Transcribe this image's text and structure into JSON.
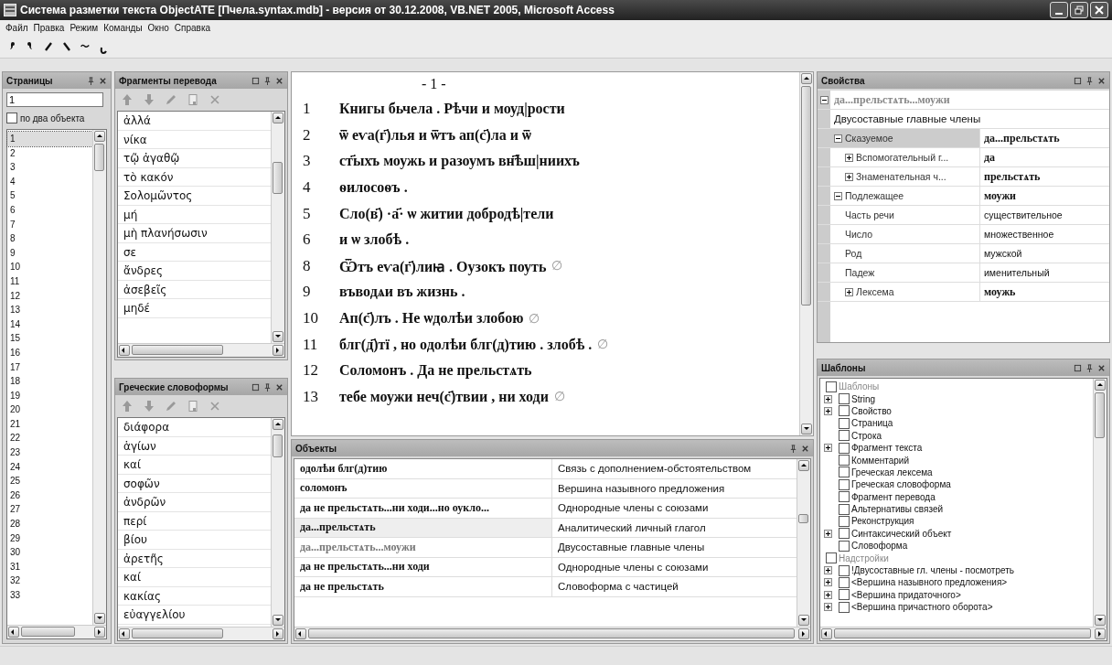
{
  "window": {
    "title": "Система разметки текста ObjectATE [Пчела.syntax.mdb] - версия от 30.12.2008, VB.NET 2005, Microsoft Access"
  },
  "menu": [
    "Файл",
    "Правка",
    "Режим",
    "Команды",
    "Окно",
    "Справка"
  ],
  "pages_pane": {
    "title": "Страницы",
    "page_field": "1",
    "pairs_checkbox": {
      "label": "по два объекта",
      "checked": false
    },
    "pages": [
      {
        "label": "1",
        "selected": true
      },
      {
        "label": "2",
        "selected": false
      },
      {
        "label": "3",
        "selected": false
      },
      {
        "label": "4",
        "selected": false
      },
      {
        "label": "5",
        "selected": false
      },
      {
        "label": "6",
        "selected": false
      },
      {
        "label": "7",
        "selected": false
      },
      {
        "label": "8",
        "selected": false
      },
      {
        "label": "9",
        "selected": false
      },
      {
        "label": "10",
        "selected": false
      },
      {
        "label": "11",
        "selected": false
      },
      {
        "label": "12",
        "selected": false
      },
      {
        "label": "13",
        "selected": false
      },
      {
        "label": "14",
        "selected": false
      },
      {
        "label": "15",
        "selected": false
      },
      {
        "label": "16",
        "selected": false
      },
      {
        "label": "17",
        "selected": false
      },
      {
        "label": "18",
        "selected": false
      },
      {
        "label": "19",
        "selected": false
      },
      {
        "label": "20",
        "selected": false
      },
      {
        "label": "21",
        "selected": false
      },
      {
        "label": "22",
        "selected": false
      },
      {
        "label": "23",
        "selected": false
      },
      {
        "label": "24",
        "selected": false
      },
      {
        "label": "25",
        "selected": false
      },
      {
        "label": "26",
        "selected": false
      },
      {
        "label": "27",
        "selected": false
      },
      {
        "label": "28",
        "selected": false
      },
      {
        "label": "29",
        "selected": false
      },
      {
        "label": "30",
        "selected": false
      },
      {
        "label": "31",
        "selected": false
      },
      {
        "label": "32",
        "selected": false
      },
      {
        "label": "33",
        "selected": false
      }
    ]
  },
  "fragments_pane": {
    "title": "Фрагменты перевода",
    "items": [
      "ἀλλά",
      "νίκα",
      "τῷ ἀγαθῷ",
      "τὸ κακόν",
      "Σολομῶντος",
      "μή",
      "μὴ πλανήσωσιν",
      "σε",
      "ἄνδρες",
      "ἀσεβεῖς",
      "μηδέ"
    ]
  },
  "greek_pane": {
    "title": "Греческие словоформы",
    "items": [
      "διάφορα",
      "ἁγίων",
      "καί",
      "σοφῶν",
      "ἀνδρῶν",
      "περί",
      "βίου",
      "ἀρετῆς",
      "καί",
      "κακίας",
      "εὐαγγελίου"
    ]
  },
  "text_view": {
    "page_label": "- 1 -",
    "lines": [
      {
        "number": "1",
        "text": "Книгы бьчела . Рѣчи и моуд|рости"
      },
      {
        "number": "2",
        "text": "ѿ еѵа(г҃)лья и ѿтъ ап(с҃)ла и ѿ"
      },
      {
        "number": "3",
        "text": "ст҃ыхъ моужь и разоумъ вн҃ѣш|ниихъ"
      },
      {
        "number": "4",
        "text": "ѳилосоѳъ ."
      },
      {
        "number": "5",
        "text": "Сло(в҃) ·а҃· ѡ житии добродѣ|тели"
      },
      {
        "number": "6",
        "text": "и ѡ злобѣ ."
      },
      {
        "number": "8",
        "text": "Ѿтъ еѵа(г҃)лиꙗ . Оузокъ поуть",
        "mark": "∅"
      },
      {
        "number": "9",
        "text": "въводѧи въ жизнь ."
      },
      {
        "number": "10",
        "text": "Ап(с҃)лъ . Не ѡдолѣи злобою",
        "mark": "∅"
      },
      {
        "number": "11",
        "text": "блг(д҃)тї , но одолѣи блг(д)тию . злобѣ .",
        "mark": "∅"
      },
      {
        "number": "12",
        "text": "Соломонъ . Да не прельстѧть"
      },
      {
        "number": "13",
        "text": "тебе моужи неч(с҃)твии , ни ходи",
        "mark": "∅"
      }
    ]
  },
  "objects_pane": {
    "title": "Объекты",
    "rows": [
      {
        "fragment": "одолѣи блг(д)тию",
        "type": "Связь с дополнением-обстоятельством",
        "selected": false,
        "current": false
      },
      {
        "fragment": "соломонъ",
        "type": "Вершина назывного предложения",
        "selected": false,
        "current": false
      },
      {
        "fragment": "да не прельстѧть...ни ходи...но оукло...",
        "type": "Однородные члены с союзами",
        "selected": false,
        "current": false
      },
      {
        "fragment": "да...прельстѧть",
        "type": "Аналитический личный глагол",
        "selected": true,
        "current": false
      },
      {
        "fragment": "да...прельстѧть...моужи",
        "type": "Двусоставные главные члены",
        "selected": false,
        "current": true
      },
      {
        "fragment": "да не прельстѧть...ни ходи",
        "type": "Однородные члены с союзами",
        "selected": false,
        "current": false
      },
      {
        "fragment": "да не прельстѧть",
        "type": "Словоформа с частицей",
        "selected": false,
        "current": false
      }
    ]
  },
  "properties_pane": {
    "title": "Свойства",
    "object": "да...прельстѧть...моужи",
    "object_expanded": true,
    "object_type": "Двусоставные главные члены",
    "rows": [
      {
        "name": "Сказуемое",
        "value": "да...прельстѧть",
        "expanded": true,
        "selected": true,
        "children": [
          {
            "name": "Вспомогательный г...",
            "value": "да",
            "expanded": false,
            "selected": false
          },
          {
            "name": "Знаменательная ч...",
            "value": "прельстѧть",
            "expanded": false,
            "selected": false
          }
        ]
      },
      {
        "name": "Подлежащее",
        "value": "моужи",
        "expanded": true,
        "selected": false,
        "children": [
          {
            "name": "Часть речи",
            "value": "существительное",
            "selected": false
          },
          {
            "name": "Число",
            "value": "множественное",
            "selected": false
          },
          {
            "name": "Род",
            "value": "мужской",
            "selected": false
          },
          {
            "name": "Падеж",
            "value": "именительный",
            "selected": false
          },
          {
            "name": "Лексема",
            "value": "моужь",
            "expanded": false,
            "selected": false
          }
        ]
      }
    ]
  },
  "templates_pane": {
    "title": "Шаблоны",
    "tree": [
      {
        "label": "Шаблоны",
        "checked": false,
        "children": [
          {
            "label": "String",
            "checked": false,
            "expanded": false
          },
          {
            "label": "Свойство",
            "checked": false,
            "expanded": false
          },
          {
            "label": "Страница",
            "checked": false
          },
          {
            "label": "Строка",
            "checked": false
          },
          {
            "label": "Фрагмент текста",
            "checked": false,
            "expanded": false
          },
          {
            "label": "Комментарий",
            "checked": false
          },
          {
            "label": "Греческая лексема",
            "checked": false
          },
          {
            "label": "Греческая словоформа",
            "checked": false
          },
          {
            "label": "Фрагмент перевода",
            "checked": false
          },
          {
            "label": "Альтернативы связей",
            "checked": false
          },
          {
            "label": "Реконструкция",
            "checked": false
          },
          {
            "label": "Синтаксический объект",
            "checked": false,
            "expanded": false
          },
          {
            "label": "Словоформа",
            "checked": false
          }
        ]
      },
      {
        "label": "Надстройки",
        "checked": false,
        "children": [
          {
            "label": "!Двусоставные гл. члены - посмотреть",
            "checked": false,
            "expanded": false
          },
          {
            "label": "<Вершина назывного предложения>",
            "checked": false,
            "expanded": false
          },
          {
            "label": "<Вершина придаточного>",
            "checked": false,
            "expanded": false
          },
          {
            "label": "<Вершина причастного оборота>",
            "checked": false,
            "expanded": false
          }
        ]
      }
    ]
  }
}
